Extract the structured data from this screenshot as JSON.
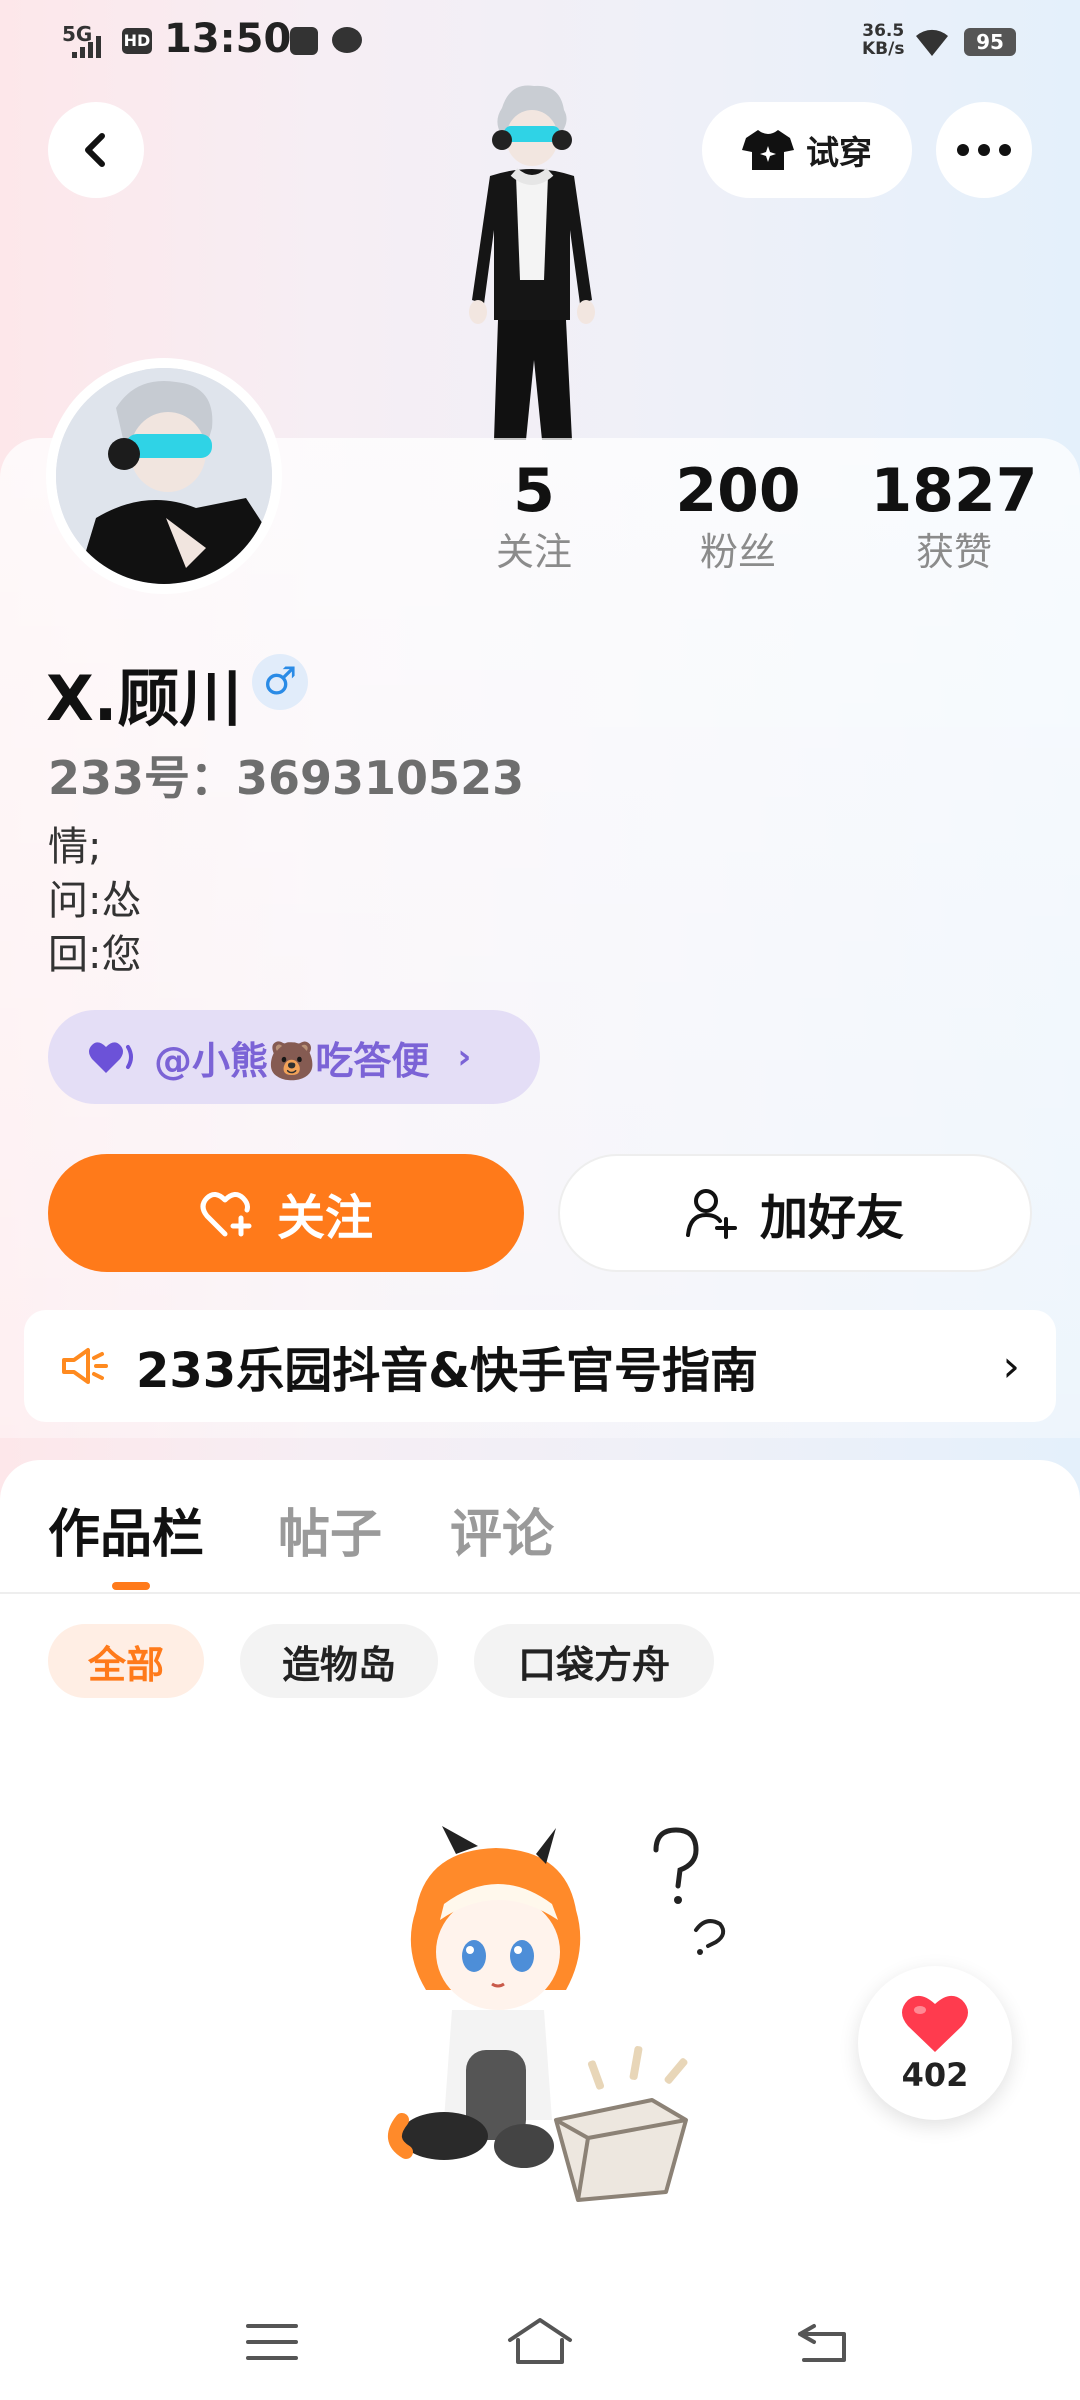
{
  "status_bar": {
    "network": "5G",
    "hd": "HD",
    "time": "13:50",
    "speed_value": "36.5",
    "speed_unit": "KB/s",
    "battery": "95"
  },
  "header": {
    "tryon_label": "试穿"
  },
  "stats": [
    {
      "value": "5",
      "label": "关注"
    },
    {
      "value": "200",
      "label": "粉丝"
    },
    {
      "value": "1827",
      "label": "获赞"
    }
  ],
  "profile": {
    "name": "X.顾川",
    "gender_symbol": "♂",
    "uid_text": "233号：369310523",
    "bio_lines": [
      "情;",
      "问:怂",
      "回:您"
    ],
    "tag_text": "@小熊🐻吃答便",
    "tag_chevron": "›"
  },
  "actions": {
    "follow_label": "关注",
    "add_friend_label": "加好友"
  },
  "notice": {
    "text": "233乐园抖音&快手官号指南",
    "chevron": "›"
  },
  "tabs": [
    {
      "label": "作品栏",
      "active": true
    },
    {
      "label": "帖子",
      "active": false
    },
    {
      "label": "评论",
      "active": false
    }
  ],
  "filters": [
    {
      "label": "全部",
      "active": true
    },
    {
      "label": "造物岛",
      "active": false
    },
    {
      "label": "口袋方舟",
      "active": false
    }
  ],
  "likes_float": {
    "count": "402"
  },
  "colors": {
    "accent": "#ff7a1a",
    "tag_purple": "#7b63d6",
    "gender_blue": "#2a8be6",
    "like_red": "#ff3b4e"
  }
}
